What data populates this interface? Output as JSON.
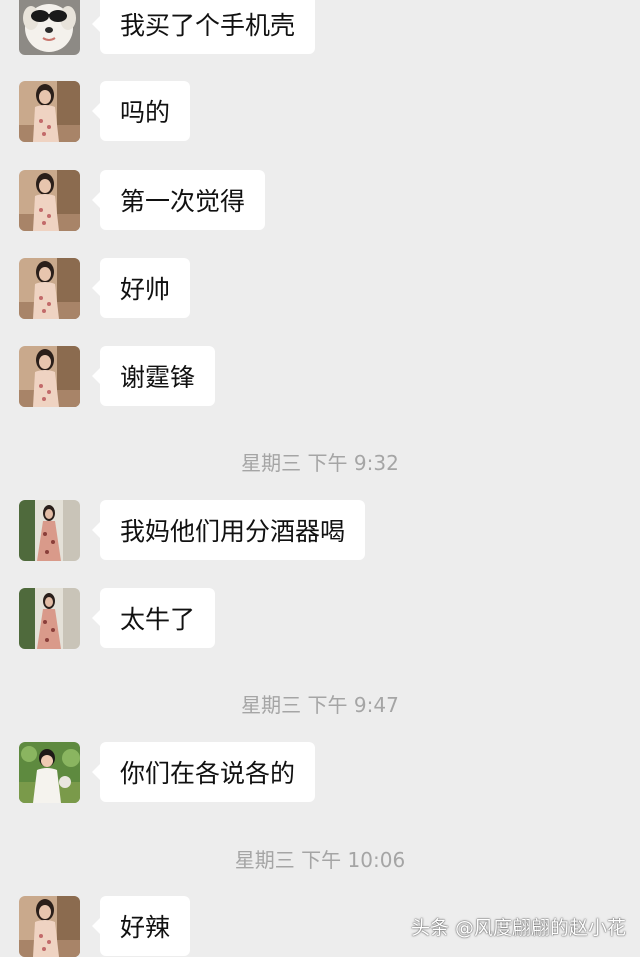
{
  "chat": {
    "messages": [
      {
        "text": "我买了个手机壳",
        "avatar": "dog-sunglasses-avatar"
      },
      {
        "text": "吗的",
        "avatar": "girl-mirror-avatar"
      },
      {
        "text": "第一次觉得",
        "avatar": "girl-mirror-avatar"
      },
      {
        "text": "好帅",
        "avatar": "girl-mirror-avatar"
      },
      {
        "text": "谢霆锋",
        "avatar": "girl-mirror-avatar"
      },
      {
        "text": "我妈他们用分酒器喝",
        "avatar": "girl-dress-avatar"
      },
      {
        "text": "太牛了",
        "avatar": "girl-dress-avatar"
      },
      {
        "text": "你们在各说各的",
        "avatar": "girl-garden-avatar"
      },
      {
        "text": "好辣",
        "avatar": "girl-mirror-avatar"
      }
    ],
    "timestamps": [
      {
        "text": "星期三 下午 9:32"
      },
      {
        "text": "星期三 下午 9:47"
      },
      {
        "text": "星期三 下午 10:06"
      }
    ]
  },
  "watermark": {
    "text": "头条 @风度翩翩的赵小花"
  },
  "colors": {
    "background": "#ededed",
    "bubble": "#ffffff",
    "text": "#111111",
    "timestamp": "#a5a5a5"
  }
}
